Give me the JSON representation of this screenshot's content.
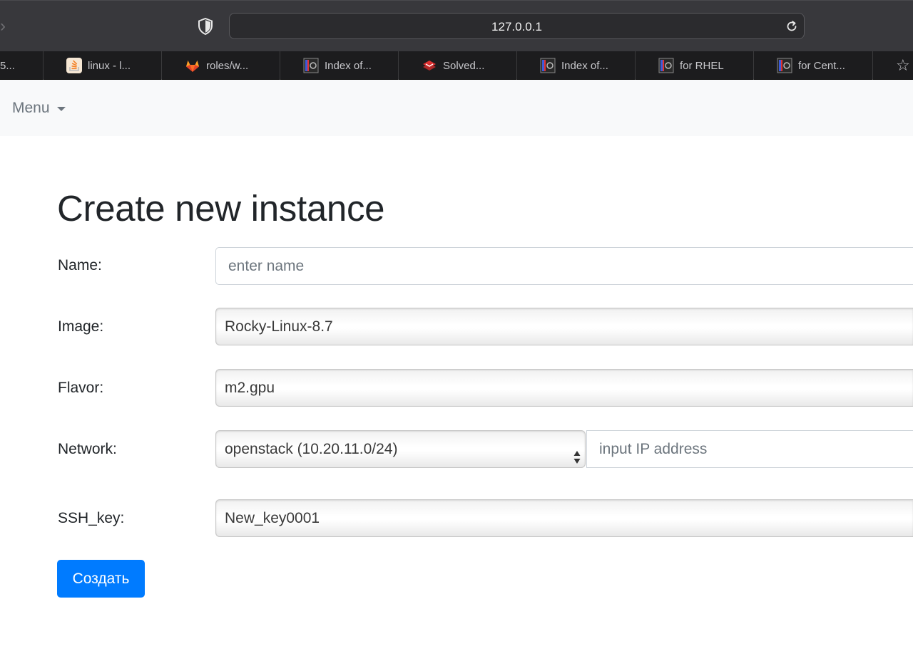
{
  "browser": {
    "url": "127.0.0.1",
    "tabs": [
      {
        "label": "5..."
      },
      {
        "label": "linux - l...",
        "icon": "stackoverflow-icon"
      },
      {
        "label": "roles/w...",
        "icon": "gitlab-icon"
      },
      {
        "label": "Index of...",
        "icon": "index-site-icon"
      },
      {
        "label": "Solved...",
        "icon": "solved-site-icon"
      },
      {
        "label": "Index of...",
        "icon": "index-site-icon"
      },
      {
        "label": "for RHEL",
        "icon": "index-site-icon"
      },
      {
        "label": "for Cent...",
        "icon": "index-site-icon"
      }
    ]
  },
  "navbar": {
    "menu_label": "Menu"
  },
  "form": {
    "title": "Create new instance",
    "name": {
      "label": "Name:",
      "placeholder": "enter name",
      "value": ""
    },
    "image": {
      "label": "Image:",
      "selected": "Rocky-Linux-8.7"
    },
    "flavor": {
      "label": "Flavor:",
      "selected": "m2.gpu"
    },
    "network": {
      "label": "Network:",
      "selected": "openstack (10.20.11.0/24)",
      "ip_placeholder": "input IP address"
    },
    "ssh_key": {
      "label": "SSH_key:",
      "selected": "New_key0001"
    },
    "submit_label": "Создать"
  },
  "colors": {
    "primary": "#007bff",
    "navbar_bg": "#f8f9fa",
    "chrome_bg": "#38383c",
    "tabbar_bg": "#1c1c1e"
  }
}
